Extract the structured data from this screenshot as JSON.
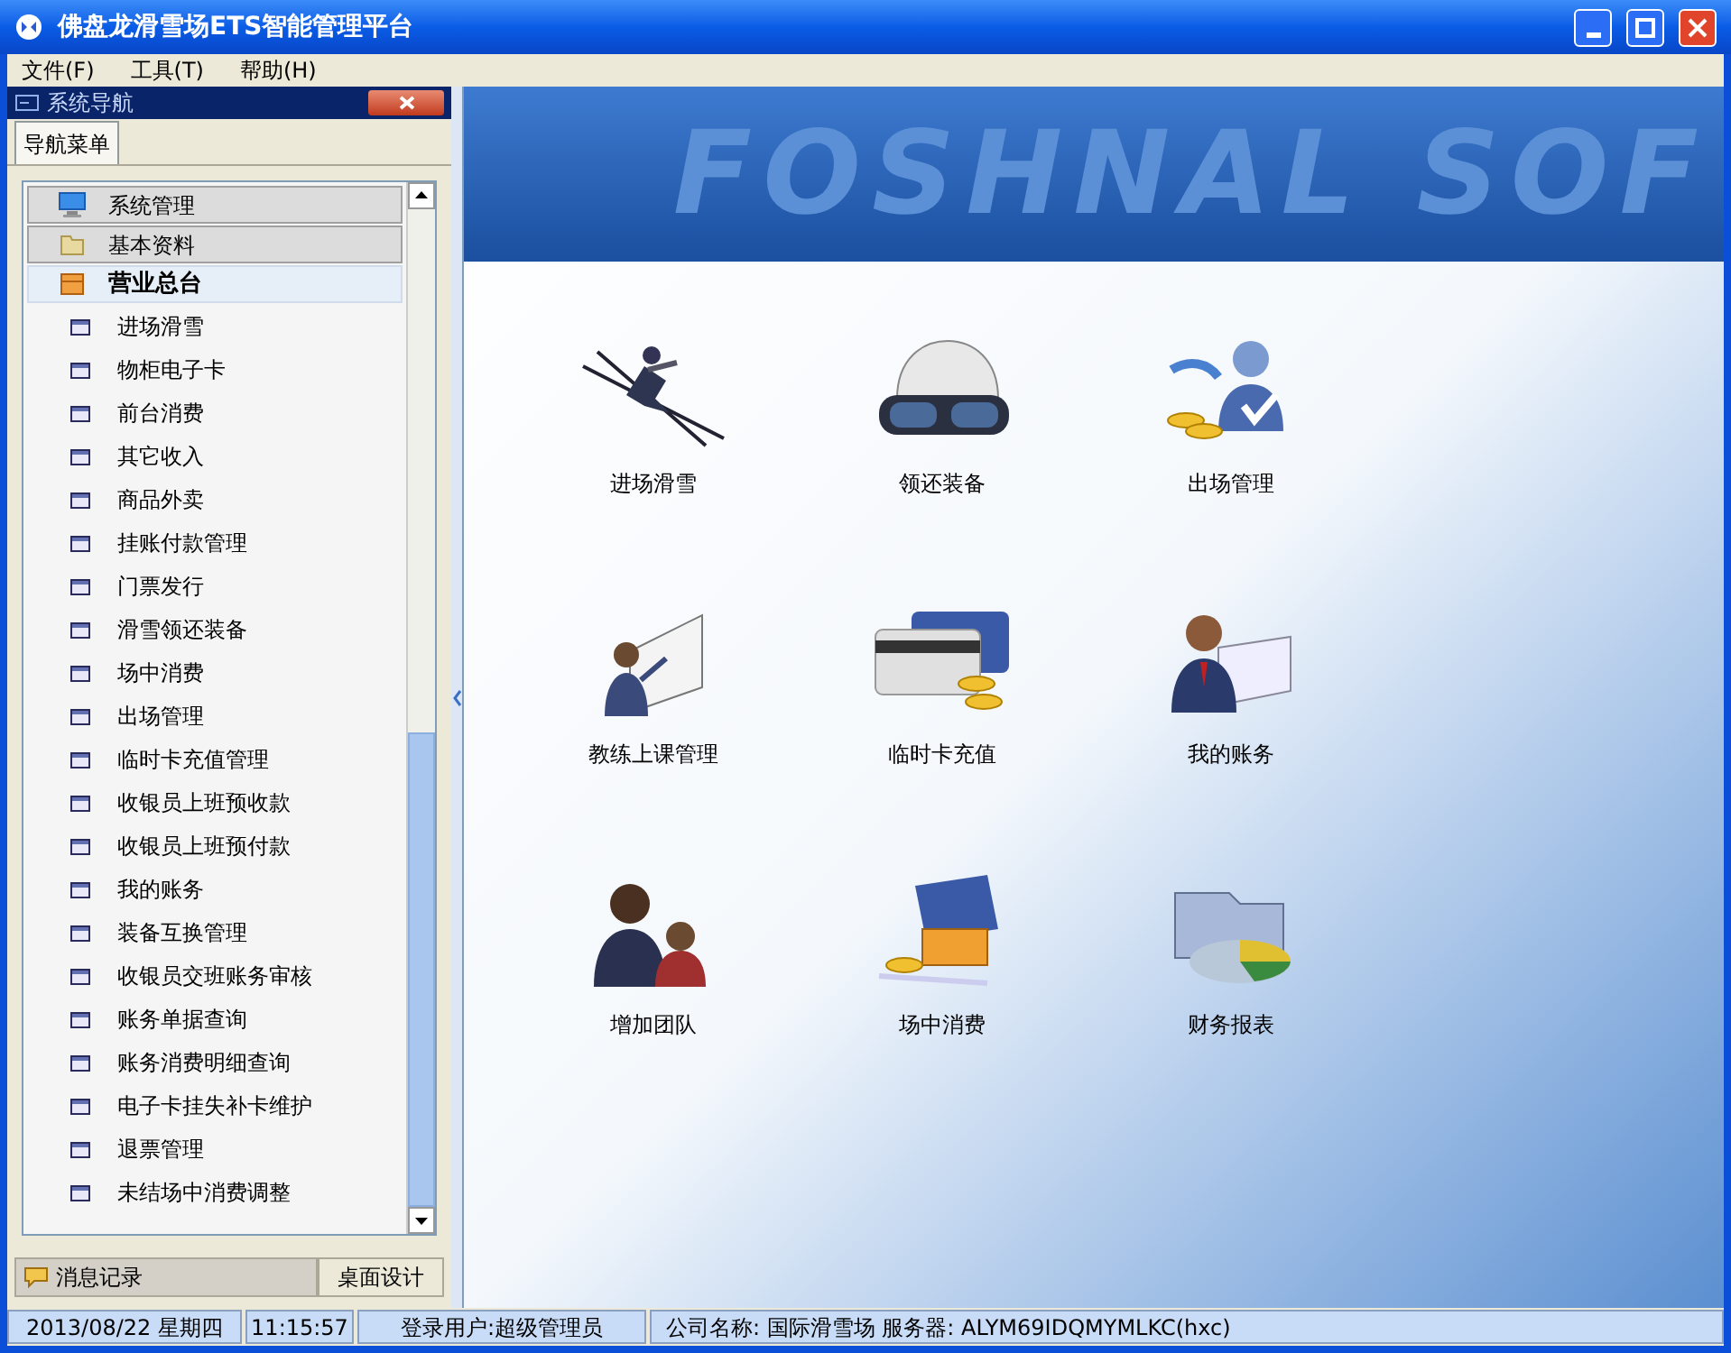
{
  "window": {
    "title": "佛盘龙滑雪场ETS智能管理平台"
  },
  "menu": [
    "文件(F)",
    "工具(T)",
    "帮助(H)"
  ],
  "nav_panel": {
    "title": "系统导航",
    "tab": "导航菜单",
    "groups": [
      {
        "label": "系统管理",
        "kind": "monitor",
        "expanded": false
      },
      {
        "label": "基本资料",
        "kind": "folder",
        "expanded": false
      },
      {
        "label": "营业总台",
        "kind": "box",
        "expanded": true,
        "children": [
          {
            "label": "进场滑雪"
          },
          {
            "label": "物柜电子卡"
          },
          {
            "label": "前台消费"
          },
          {
            "label": "其它收入"
          },
          {
            "label": "商品外卖"
          },
          {
            "label": "挂账付款管理"
          },
          {
            "label": "门票发行"
          },
          {
            "label": "滑雪领还装备"
          },
          {
            "label": "场中消费"
          },
          {
            "label": "出场管理"
          },
          {
            "label": "临时卡充值管理"
          },
          {
            "label": "收银员上班预收款"
          },
          {
            "label": "收银员上班预付款"
          },
          {
            "label": "我的账务"
          },
          {
            "label": "装备互换管理"
          },
          {
            "label": "收银员交班账务审核"
          },
          {
            "label": "账务单据查询"
          },
          {
            "label": "账务消费明细查询"
          },
          {
            "label": "电子卡挂失补卡维护"
          },
          {
            "label": "退票管理"
          },
          {
            "label": "未结场中消费调整"
          }
        ]
      }
    ],
    "bottom_tab": "消息记录",
    "bottom_button": "桌面设计"
  },
  "banner": {
    "text": "FOSHNAL SOF"
  },
  "desktop_shortcuts": [
    {
      "label": "进场滑雪",
      "kind": "skier"
    },
    {
      "label": "领还装备",
      "kind": "helmet"
    },
    {
      "label": "出场管理",
      "kind": "exit"
    },
    {
      "label": "教练上课管理",
      "kind": "teacher"
    },
    {
      "label": "临时卡充值",
      "kind": "card"
    },
    {
      "label": "我的账务",
      "kind": "person"
    },
    {
      "label": "增加团队",
      "kind": "team"
    },
    {
      "label": "场中消费",
      "kind": "cash"
    },
    {
      "label": "财务报表",
      "kind": "report"
    }
  ],
  "status_bar": [
    "2013/08/22 星期四",
    "11:15:57",
    "登录用户:超级管理员",
    "公司名称: 国际滑雪场 服务器: ALYM69IDQMYMLKC(hxc)"
  ]
}
